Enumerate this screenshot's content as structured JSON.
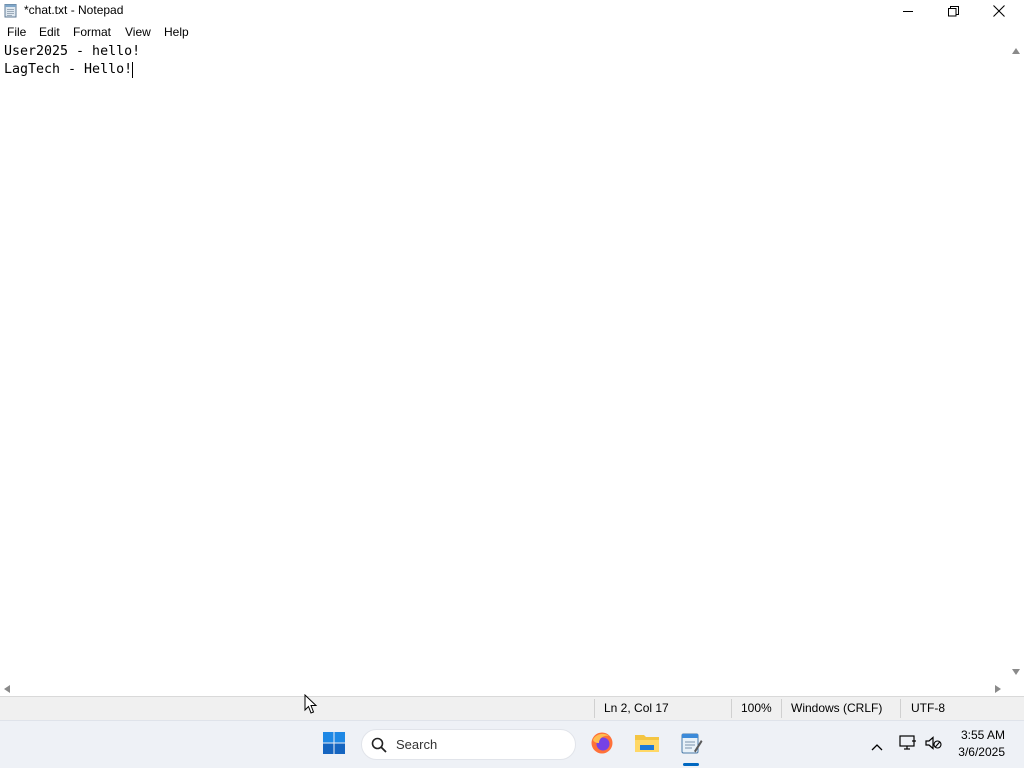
{
  "window": {
    "title": "*chat.txt - Notepad",
    "icon": "notepad-icon"
  },
  "menu": {
    "items": [
      "File",
      "Edit",
      "Format",
      "View",
      "Help"
    ]
  },
  "editor": {
    "lines": [
      "User2025 - hello!",
      "LagTech - Hello!"
    ]
  },
  "status": {
    "position": "Ln 2, Col 17",
    "zoom": "100%",
    "line_ending": "Windows (CRLF)",
    "encoding": "UTF-8"
  },
  "taskbar": {
    "search_placeholder": "Search",
    "time": "3:55 AM",
    "date": "3/6/2025",
    "pinned": [
      "windows-start-icon",
      "firefox-icon",
      "file-explorer-icon",
      "notepad-icon"
    ],
    "accent": "#0067c0"
  }
}
